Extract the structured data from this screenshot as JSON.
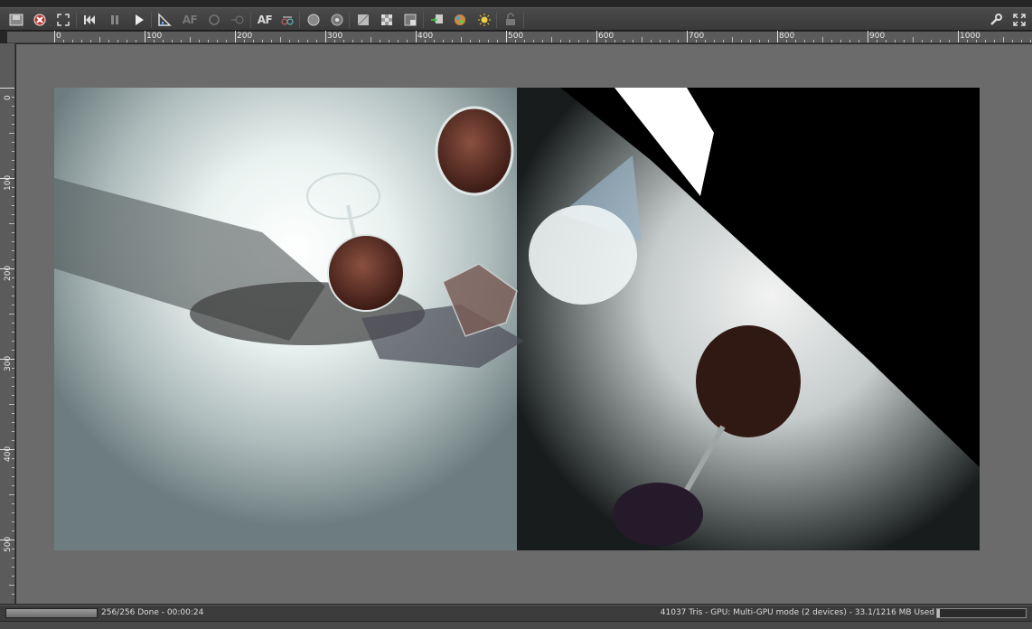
{
  "toolbar": {
    "buttons": [
      {
        "name": "save-image-icon"
      },
      {
        "name": "cancel-render-icon"
      },
      {
        "name": "fit-view-icon"
      },
      {
        "name": "restart-icon"
      },
      {
        "name": "pause-icon"
      },
      {
        "name": "play-icon"
      },
      {
        "name": "focus-pick-icon"
      },
      {
        "name": "autofocus-pick-icon"
      },
      {
        "name": "rotate-icon"
      },
      {
        "name": "region-icon"
      },
      {
        "name": "autofocus-toggle",
        "label": "AF"
      },
      {
        "name": "stereo-icon"
      },
      {
        "name": "sphere-a-icon"
      },
      {
        "name": "sphere-b-icon"
      },
      {
        "name": "alpha-icon"
      },
      {
        "name": "checker-icon"
      },
      {
        "name": "compare-icon"
      },
      {
        "name": "import-icon"
      },
      {
        "name": "color-pick-icon"
      },
      {
        "name": "light-icon"
      },
      {
        "name": "lock-icon"
      },
      {
        "name": "settings-wrench-icon"
      },
      {
        "name": "fullscreen-icon"
      }
    ]
  },
  "ruler_h": [
    "0",
    "100",
    "200",
    "300",
    "400",
    "500",
    "600",
    "700",
    "800",
    "900",
    "1000"
  ],
  "ruler_v": [
    "0",
    "100",
    "200",
    "300",
    "400",
    "500"
  ],
  "status": {
    "progress_fraction": 1.0,
    "left_text": "256/256 Done - 00:00:24",
    "right_text": "41037 Tris - GPU: Multi-GPU mode (2 devices) - 33.1/1216 MB Used",
    "memory_fraction": 0.027
  }
}
